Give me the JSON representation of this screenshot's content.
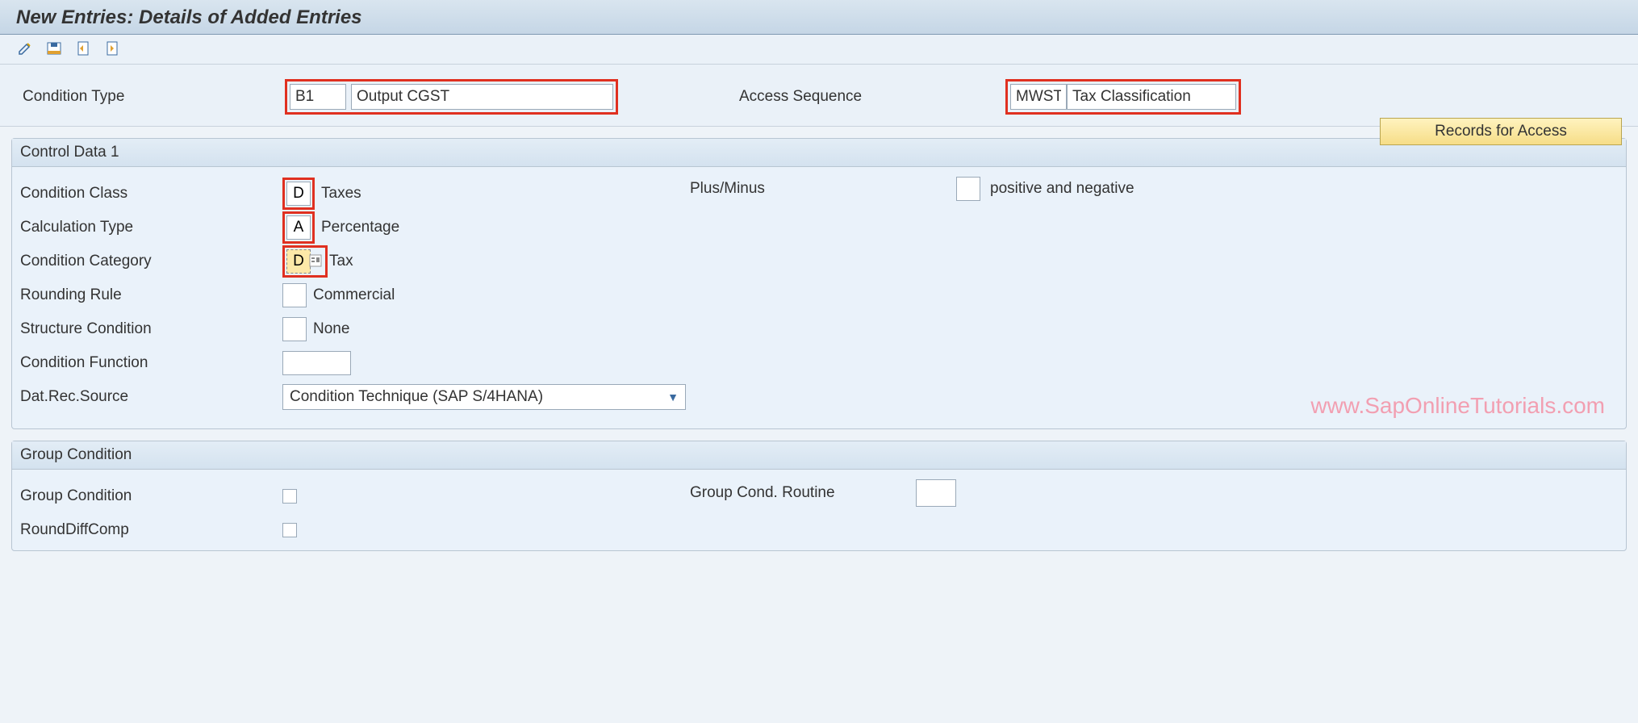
{
  "title": "New Entries: Details of Added Entries",
  "header": {
    "condition_type_label": "Condition Type",
    "condition_type_code": "B1",
    "condition_type_desc": "Output CGST",
    "access_sequence_label": "Access Sequence",
    "access_sequence_code": "MWST",
    "access_sequence_desc": "Tax Classification",
    "records_button": "Records for Access"
  },
  "panel1": {
    "title": "Control Data 1",
    "condition_class_label": "Condition Class",
    "condition_class_code": "D",
    "condition_class_desc": "Taxes",
    "calculation_type_label": "Calculation Type",
    "calculation_type_code": "A",
    "calculation_type_desc": "Percentage",
    "condition_category_label": "Condition Category",
    "condition_category_code": "D",
    "condition_category_desc": "Tax",
    "rounding_rule_label": "Rounding Rule",
    "rounding_rule_code": "",
    "rounding_rule_desc": "Commercial",
    "structure_condition_label": "Structure Condition",
    "structure_condition_code": "",
    "structure_condition_desc": "None",
    "condition_function_label": "Condition Function",
    "condition_function_code": "",
    "dat_rec_source_label": "Dat.Rec.Source",
    "dat_rec_source_value": "Condition Technique (SAP S/4HANA)",
    "plus_minus_label": "Plus/Minus",
    "plus_minus_code": "",
    "plus_minus_desc": "positive and negative"
  },
  "panel2": {
    "title": "Group Condition",
    "group_condition_label": "Group Condition",
    "rounddiffcomp_label": "RoundDiffComp",
    "group_cond_routine_label": "Group Cond. Routine"
  },
  "watermark": "www.SapOnlineTutorials.com"
}
